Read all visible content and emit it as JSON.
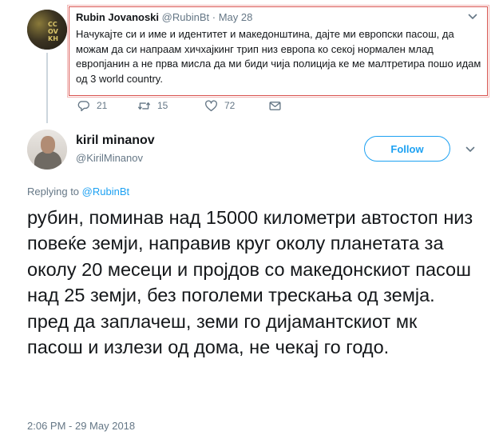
{
  "parent_tweet": {
    "author_name": "Rubin Jovanoski",
    "author_handle": "@RubinBt",
    "separator": "·",
    "date": "May 28",
    "text": "Начукајте си и име и идентитет и македонштина, дајте ми европски пасош, да можам да си напраам хичхајкинг трип низ европа ко секој нормален млад европјанин а не прва мисла да ми биди чија полиција ке ме малтретира пошо идам од 3 world country.",
    "actions": {
      "reply_count": "21",
      "retweet_count": "15",
      "like_count": "72"
    },
    "icons": [
      "reply-icon",
      "retweet-icon",
      "heart-icon",
      "mail-icon",
      "chevron-down-icon"
    ]
  },
  "main_tweet": {
    "author_name": "kiril minanov",
    "author_handle": "@KirilMinanov",
    "follow_label": "Follow",
    "replying_prefix": "Replying to",
    "replying_to": "@RubinBt",
    "text": "рубин, поминав над 15000 километри автостоп низ повеќе земји, направив круг околу планетата за околу 20 месеци и пројдов со македонскиот пасош над 25 земји, без поголеми трескања од земја. пред да заплачеш, земи го дијамантскиот мк пасош и излези од дома, не чекај го годо.",
    "timestamp": "2:06 PM - 29 May 2018"
  },
  "colors": {
    "accent": "#1da1f2",
    "secondary_text": "#657786",
    "primary_text": "#14171a",
    "highlight_border": "#d9534f"
  }
}
